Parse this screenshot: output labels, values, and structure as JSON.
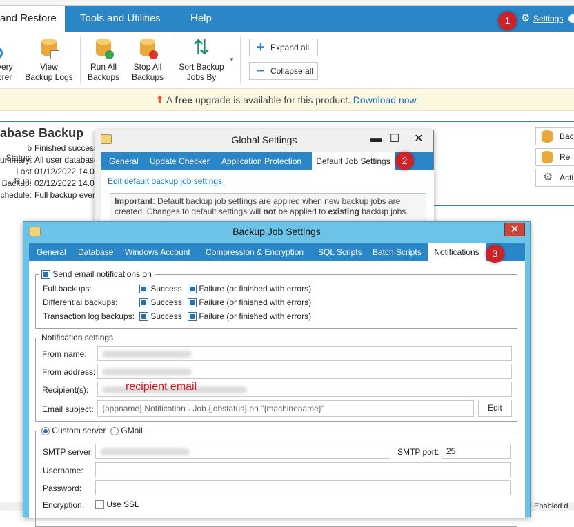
{
  "main_window": {
    "ribbon_tabs": [
      "and Restore",
      "Tools and Utilities",
      "Help"
    ],
    "settings_link": "Settings",
    "ribbon_buttons": [
      {
        "label": "very\norer"
      },
      {
        "label": "View\nBackup Logs"
      },
      {
        "label": "Run All\nBackups"
      },
      {
        "label": "Stop All\nBackups"
      },
      {
        "label": "Sort Backup\nJobs By"
      }
    ],
    "expand_all": "Expand all",
    "collapse_all": "Collapse all",
    "upgrade_prefix": "A",
    "upgrade_free": "free",
    "upgrade_mid": "upgrade is available for this product.",
    "upgrade_link": "Download now.",
    "job_title": "abase Backup",
    "job_labels": [
      "b Status:",
      "ummary:",
      "Last Run:",
      "Backup:",
      "chedule:"
    ],
    "job_values": [
      "Finished success",
      "All user database",
      "01/12/2022 14.00",
      "02/12/2022 14.00",
      "Full backup ever"
    ],
    "right_buttons": [
      "Back",
      "Re",
      "Acti"
    ]
  },
  "badges": [
    "1",
    "2",
    "3"
  ],
  "global_settings": {
    "title": "Global Settings",
    "tabs": [
      "General",
      "Update Checker",
      "Application Protection",
      "Default Job Settings"
    ],
    "edit_link": "Edit default backup job settings",
    "important_label": "Important",
    "important_text1": ": Default backup job settings are applied when new backup jobs are",
    "important_text2a": "created. Changes to default settings will",
    "important_not": "not",
    "important_text2b": "be applied to",
    "important_existing": "existing",
    "important_text2c": "backup jobs."
  },
  "backup_job_settings": {
    "title": "Backup Job Settings",
    "tabs": [
      "General",
      "Database",
      "Windows Account",
      "Compression & Encryption",
      "SQL Scripts",
      "Batch Scripts",
      "Notifications"
    ],
    "send_email_label": "Send email notifications on",
    "rows": [
      {
        "label": "Full backups:",
        "success": "Success",
        "failure": "Failure (or finished with errors)"
      },
      {
        "label": "Differential backups:",
        "success": "Success",
        "failure": "Failure (or finished with errors)"
      },
      {
        "label": "Transaction log backups:",
        "success": "Success",
        "failure": "Failure (or finished with errors)"
      }
    ],
    "notification_settings_caption": "Notification settings",
    "from_name_label": "From name:",
    "from_address_label": "From address:",
    "recipients_label": "Recipient(s):",
    "recipients_annotation": "recipient email",
    "email_subject_label": "Email subject:",
    "email_subject_value": "{appname} Notification - Job {jobstatus} on \"{machinename}\"",
    "edit_button": "Edit",
    "custom_server_label": "Custom server",
    "gmail_label": "GMail",
    "smtp_server_label": "SMTP server:",
    "smtp_port_label": "SMTP port:",
    "smtp_port_value": "25",
    "username_label": "Username:",
    "password_label": "Password:",
    "encryption_label": "Encryption:",
    "use_ssl_label": "Use SSL"
  },
  "statusbar_right": "Enabled d",
  "colors": {
    "accent": "#2b86c7",
    "badge": "#c9242b",
    "annotation": "#e0141c",
    "upgrade_bg": "#fcf8df"
  }
}
